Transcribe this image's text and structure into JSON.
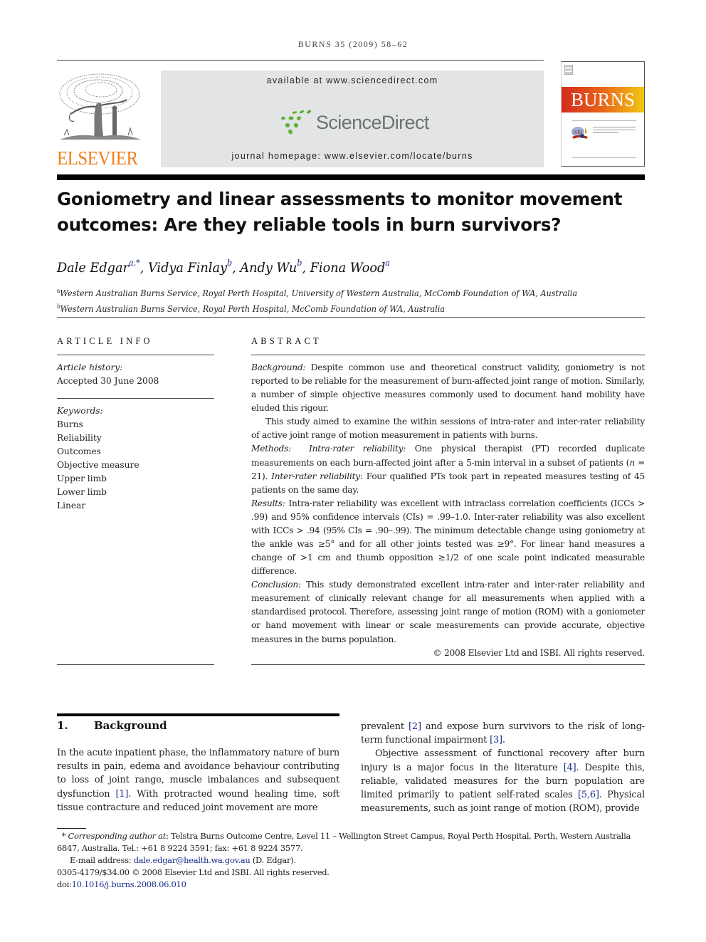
{
  "running_head": "BURNS 35 (2009) 58–62",
  "header": {
    "publisher_logo": "ELSEVIER",
    "available_at": "available at www.sciencedirect.com",
    "sciencedirect_logo": "ScienceDirect",
    "journal_homepage": "journal homepage: www.elsevier.com/locate/burns",
    "journal_cover_title": "BURNS",
    "colors": {
      "elsevier_orange": "#f07f1a",
      "sd_green": "#5cb233",
      "sd_gray": "#6d7372",
      "sd_box_bg": "#e3e4e5",
      "cover_gradient_start": "#d42a1e",
      "cover_gradient_end": "#f2c813",
      "link_blue": "#1a2b8c"
    }
  },
  "article": {
    "title_line1": "Goniometry and linear assessments to monitor movement",
    "title_line2": "outcomes: Are they reliable tools in burn survivors?",
    "authors": [
      {
        "name": "Dale Edgar",
        "sup": "a,*",
        "sep": ", "
      },
      {
        "name": "Vidya Finlay",
        "sup": "b",
        "sep": ", "
      },
      {
        "name": "Andy Wu",
        "sup": "b",
        "sep": ", "
      },
      {
        "name": "Fiona Wood",
        "sup": "a",
        "sep": ""
      }
    ],
    "affiliations": [
      {
        "mark": "a",
        "text": "Western Australian Burns Service, Royal Perth Hospital, University of Western Australia, McComb Foundation of WA, Australia"
      },
      {
        "mark": "b",
        "text": "Western Australian Burns Service, Royal Perth Hospital, McComb Foundation of WA, Australia"
      }
    ]
  },
  "article_info": {
    "heading": "ARTICLE INFO",
    "history_label": "Article history:",
    "accepted": "Accepted 30 June 2008",
    "keywords_label": "Keywords:",
    "keywords": [
      "Burns",
      "Reliability",
      "Outcomes",
      "Objective measure",
      "Upper limb",
      "Lower limb",
      "Linear"
    ]
  },
  "abstract": {
    "heading": "ABSTRACT",
    "background_label": "Background:",
    "background_text": " Despite common use and theoretical construct validity, goniometry is not reported to be reliable for the measurement of burn-affected joint range of motion. Similarly, a number of simple objective measures commonly used to document hand mobility have eluded this rigour.",
    "aim_text": "This study aimed to examine the within sessions of intra-rater and inter-rater reliability of active joint range of motion measurement in patients with burns.",
    "methods_label": "Methods:",
    "methods_sub1": "Intra-rater reliability:",
    "methods_text1": " One physical therapist (PT) recorded duplicate measurements on each burn-affected joint after a 5-min interval in a subset of patients (",
    "methods_n": "n",
    "methods_text1b": " = 21). ",
    "methods_sub2": "Inter-rater reliability",
    "methods_text2": ": Four qualified PTs took part in repeated measures testing of 45 patients on the same day.",
    "results_label": "Results:",
    "results_text": " Intra-rater reliability was excellent with intraclass correlation coefficients (ICCs > .99) and 95% confidence intervals (CIs) = .99–1.0. Inter-rater reliability was also excellent with ICCs > .94 (95% CIs = .90–.99). The minimum detectable change using goniometry at the ankle was ≥5° and for all other joints tested was ≥9°. For linear hand measures a change of >1 cm and thumb opposition ≥1/2 of one scale point indicated measurable difference.",
    "conclusion_label": "Conclusion:",
    "conclusion_text": " This study demonstrated excellent intra-rater and inter-rater reliability and measurement of clinically relevant change for all measurements when applied with a standardised protocol. Therefore, assessing joint range of motion (ROM) with a goniometer or hand movement with linear or scale measurements can provide accurate, objective measures in the burns population.",
    "copyright": "© 2008 Elsevier Ltd and ISBI. All rights reserved."
  },
  "section1": {
    "number": "1.",
    "title": "Background",
    "col1": {
      "t1": "In the acute inpatient phase, the inflammatory nature of burn results in pain, edema and avoidance behaviour contributing to loss of joint range, muscle imbalances and subsequent dysfunction ",
      "r1": "[1]",
      "t2": ". With protracted wound healing time, soft tissue contracture and reduced joint movement are more"
    },
    "col2": {
      "t1": "prevalent ",
      "r1": "[2]",
      "t2": " and expose burn survivors to the risk of long-term functional impairment ",
      "r2": "[3]",
      "t3": ".",
      "p2_t1": "Objective assessment of functional recovery after burn injury is a major focus in the literature ",
      "p2_r1": "[4]",
      "p2_t2": ". Despite this, reliable, validated measures for the burn population are limited primarily to patient self-rated scales ",
      "p2_r2": "[5,6]",
      "p2_t3": ". Physical measurements, such as joint range of motion (ROM), provide"
    }
  },
  "footnotes": {
    "star": "* ",
    "corr_label": "Corresponding author at",
    "corr_text": ": Telstra Burns Outcome Centre, Level 11 – Wellington Street Campus, Royal Perth Hospital, Perth, Western Australia 6847, Australia. Tel.: +61 8 9224 3591; fax: +61 8 9224 3577.",
    "email_label": "E-mail address: ",
    "email": "dale.edgar@health.wa.gov.au",
    "email_suffix": " (D. Edgar).",
    "issn_line": "0305-4179/$34.00 © 2008 Elsevier Ltd and ISBI. All rights reserved.",
    "doi_prefix": "doi:",
    "doi": "10.1016/j.burns.2008.06.010"
  }
}
